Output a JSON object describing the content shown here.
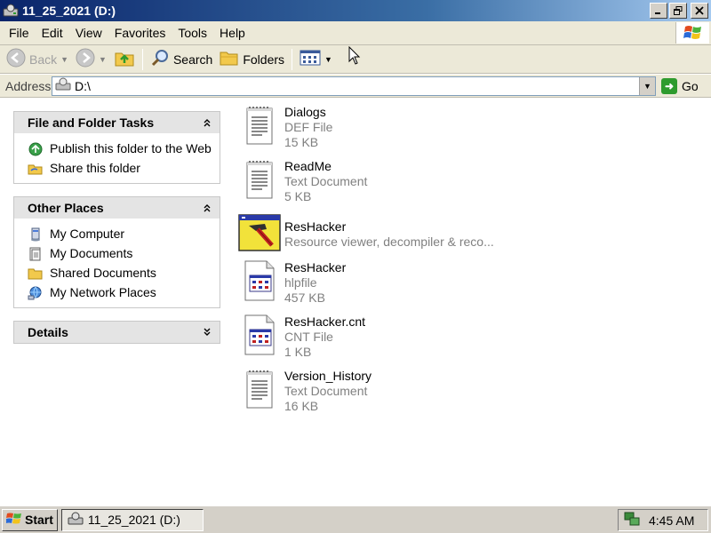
{
  "window": {
    "title": "11_25_2021 (D:)"
  },
  "menu": [
    "File",
    "Edit",
    "View",
    "Favorites",
    "Tools",
    "Help"
  ],
  "toolbar": {
    "back": "Back",
    "search": "Search",
    "folders": "Folders"
  },
  "address": {
    "label": "Address",
    "value": "D:\\",
    "go": "Go"
  },
  "taskpane": {
    "file_folder_tasks": {
      "title": "File and Folder Tasks",
      "items": [
        "Publish this folder to the Web",
        "Share this folder"
      ]
    },
    "other_places": {
      "title": "Other Places",
      "items": [
        "My Computer",
        "My Documents",
        "Shared Documents",
        "My Network Places"
      ]
    },
    "details": {
      "title": "Details"
    }
  },
  "files": [
    {
      "name": "Dialogs",
      "type": "DEF File",
      "size": "15 KB",
      "icon": "text-document-icon"
    },
    {
      "name": "ReadMe",
      "type": "Text Document",
      "size": "5 KB",
      "icon": "text-document-icon"
    },
    {
      "name": "ResHacker",
      "type": "Resource viewer, decompiler & reco...",
      "size": "",
      "icon": "reshacker-app-icon"
    },
    {
      "name": "ResHacker",
      "type": "hlpfile",
      "size": "457 KB",
      "icon": "help-file-icon"
    },
    {
      "name": "ResHacker.cnt",
      "type": "CNT File",
      "size": "1 KB",
      "icon": "help-file-icon"
    },
    {
      "name": "Version_History",
      "type": "Text Document",
      "size": "16 KB",
      "icon": "text-document-icon"
    }
  ],
  "taskbar": {
    "start": "Start",
    "task": "11_25_2021 (D:)",
    "clock": "4:45 AM"
  }
}
